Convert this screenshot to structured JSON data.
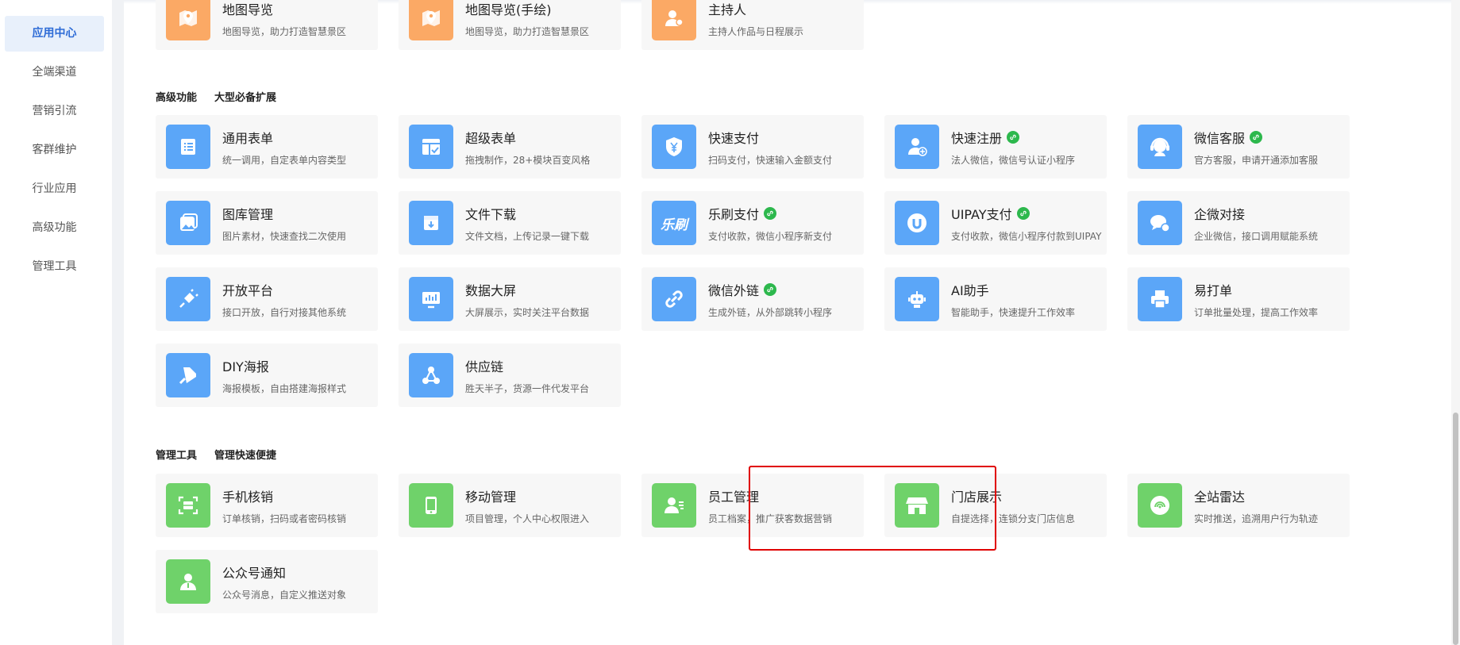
{
  "sidebar": {
    "items": [
      {
        "label": "应用中心",
        "active": true
      },
      {
        "label": "全端渠道"
      },
      {
        "label": "营销引流"
      },
      {
        "label": "客群维护"
      },
      {
        "label": "行业应用"
      },
      {
        "label": "高级功能"
      },
      {
        "label": "管理工具"
      }
    ]
  },
  "sections": {
    "advanced": {
      "title": "高级功能",
      "subtitle": "大型必备扩展"
    },
    "tools": {
      "title": "管理工具",
      "subtitle": "管理快速便捷"
    }
  },
  "cards": {
    "map_guide": {
      "title": "地图导览",
      "desc": "地图导览，助力打造智慧景区",
      "icon": "map-icon"
    },
    "map_guide_hand": {
      "title": "地图导览(手绘)",
      "desc": "地图导览，助力打造智慧景区",
      "icon": "map-icon"
    },
    "host": {
      "title": "主持人",
      "desc": "主持人作品与日程展示",
      "icon": "host-icon"
    },
    "general_form": {
      "title": "通用表单",
      "desc": "统一调用，自定表单内容类型",
      "icon": "list-icon"
    },
    "super_form": {
      "title": "超级表单",
      "desc": "拖拽制作，28+模块百变风格",
      "icon": "form-icon"
    },
    "quick_pay": {
      "title": "快速支付",
      "desc": "扫码支付，快速输入金额支付",
      "icon": "yen-shield-icon"
    },
    "quick_register": {
      "title": "快速注册",
      "desc": "法人微信，微信号认证小程序",
      "icon": "user-add-icon",
      "link": true
    },
    "wechat_service": {
      "title": "微信客服",
      "desc": "官方客服，申请开通添加客服",
      "icon": "headset-icon",
      "link": true
    },
    "gallery": {
      "title": "图库管理",
      "desc": "图片素材，快速查找二次使用",
      "icon": "gallery-icon"
    },
    "file_download": {
      "title": "文件下载",
      "desc": "文件文档，上传记录一键下载",
      "icon": "download-box-icon"
    },
    "leshua_pay": {
      "title": "乐刷支付",
      "desc": "支付收款，微信小程序新支付",
      "icon": "leshua-logo-icon",
      "link": true,
      "logo_text": "乐刷"
    },
    "uipay": {
      "title": "UIPAY支付",
      "desc": "支付收款，微信小程序付款到UIPAY",
      "icon": "uipay-logo-icon",
      "link": true
    },
    "wecom_dock": {
      "title": "企微对接",
      "desc": "企业微信，接口调用赋能系统",
      "icon": "wecom-icon"
    },
    "open_platform": {
      "title": "开放平台",
      "desc": "接口开放，自行对接其他系统",
      "icon": "plug-icon"
    },
    "data_screen": {
      "title": "数据大屏",
      "desc": "大屏展示，实时关注平台数据",
      "icon": "monitor-chart-icon"
    },
    "wechat_link": {
      "title": "微信外链",
      "desc": "生成外链，从外部跳转小程序",
      "icon": "chain-link-icon",
      "link": true
    },
    "ai_assistant": {
      "title": "AI助手",
      "desc": "智能助手，快速提升工作效率",
      "icon": "robot-icon"
    },
    "easy_print": {
      "title": "易打单",
      "desc": "订单批量处理，提高工作效率",
      "icon": "printer-icon"
    },
    "diy_poster": {
      "title": "DIY海报",
      "desc": "海报模板，自由搭建海报样式",
      "icon": "brush-icon"
    },
    "supply_chain": {
      "title": "供应链",
      "desc": "胜天半子，货源一件代发平台",
      "icon": "network-icon"
    },
    "mobile_verify": {
      "title": "手机核销",
      "desc": "订单核销，扫码或者密码核销",
      "icon": "scan-icon"
    },
    "mobile_manage": {
      "title": "移动管理",
      "desc": "项目管理，个人中心权限进入",
      "icon": "phone-icon"
    },
    "staff_manage": {
      "title": "员工管理",
      "desc": "员工档案，推广获客数据营销",
      "icon": "staff-icon"
    },
    "store_display": {
      "title": "门店展示",
      "desc": "自提选择，连锁分支门店信息",
      "icon": "store-icon"
    },
    "site_radar": {
      "title": "全站雷达",
      "desc": "实时推送，追溯用户行为轨迹",
      "icon": "radar-icon"
    },
    "mp_notice": {
      "title": "公众号通知",
      "desc": "公众号消息，自定义推送对象",
      "icon": "person-icon"
    }
  },
  "colors": {
    "orange": "#fba965",
    "blue": "#5ba6f8",
    "green": "#6fd26a",
    "link_badge": "#2db84d",
    "highlight": "#e00000",
    "active_nav": "#2d6bd6"
  }
}
